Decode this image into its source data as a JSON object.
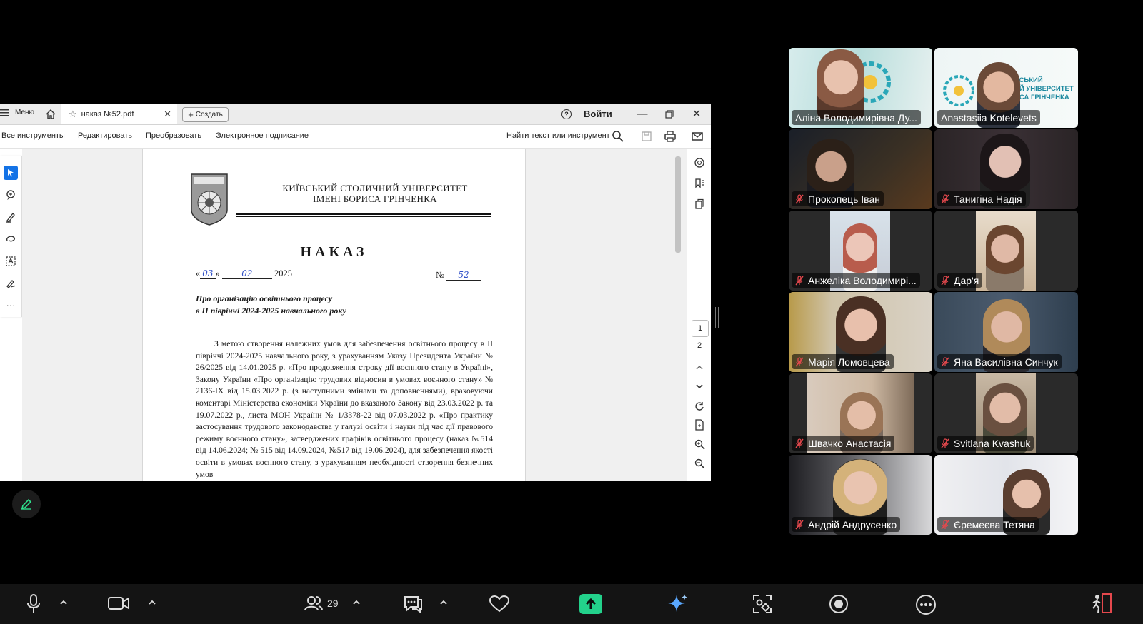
{
  "pdf_viewer": {
    "menu_label": "Меню",
    "tab_title": "наказ №52.pdf",
    "create_label": "Создать",
    "login_label": "Войти",
    "tools": [
      "Все инструменты",
      "Редактировать",
      "Преобразовать",
      "Электронное подписание"
    ],
    "find_placeholder": "Найти текст или инструмент",
    "page_numbers": [
      "1",
      "2"
    ]
  },
  "document": {
    "university": "КИЇВСЬКИЙ СТОЛИЧНИЙ УНІВЕРСИТЕТ",
    "university_sub": "ІМЕНІ БОРИСА ГРІНЧЕНКА",
    "heading": "НАКАЗ",
    "date_open": "«",
    "date_day": "03",
    "date_close": "»",
    "date_month": "02",
    "date_year": "2025",
    "number_label": "№",
    "number_value": "52",
    "subject_line1": "Про організацію освітнього процесу",
    "subject_line2": "в ІІ півріччі 2024-2025 навчального року",
    "body": "З метою створення належних умов для забезпечення освітнього процесу в ІІ півріччі 2024-2025 навчального року, з урахуванням Указу Президента України № 26/2025 від 14.01.2025 р. «Про продовження строку дії воєнного стану в Україні», Закону України «Про організацію трудових відносин в умовах воєнного стану» № 2136-ІХ від 15.03.2022 р. (з наступними змінами та доповненнями), враховуючи коментарі Міністерства економіки України до вказаного Закону від 23.03.2022 р. та 19.07.2022 р., листа МОН України № 1/3378-22 від 07.03.2022 р. «Про практику застосування трудового законодавства у галузі освіти і науки під час дії правового режиму воєнного стану», затверджених графіків освітнього процесу (наказ №514 від 14.06.2024; № 515 від 14.09.2024, №517 від 19.06.2024), для забезпечення якості освіти в умовах воєнного стану, з урахуванням необхідності створення безпечних умов"
  },
  "participants": [
    {
      "name": "Аліна Володимирівна Ду...",
      "muted": false,
      "speaking": true
    },
    {
      "name": "Anastasiia Kotelevets",
      "muted": false,
      "speaking": false
    },
    {
      "name": "Прокопець Іван",
      "muted": true,
      "speaking": false
    },
    {
      "name": "Танигіна Надія",
      "muted": true,
      "speaking": false
    },
    {
      "name": "Анжеліка Володимирі...",
      "muted": true,
      "speaking": false
    },
    {
      "name": "Дар'я",
      "muted": true,
      "speaking": false
    },
    {
      "name": "Марія Ломовцева",
      "muted": true,
      "speaking": false
    },
    {
      "name": "Яна Василівна Синчук",
      "muted": true,
      "speaking": false
    },
    {
      "name": "Швачко Анастасія",
      "muted": true,
      "speaking": false
    },
    {
      "name": "Svitlana Kvashuk",
      "muted": true,
      "speaking": false
    },
    {
      "name": "Андрій Андрусенко",
      "muted": true,
      "speaking": false
    },
    {
      "name": "Єремеєва Тетяна",
      "muted": true,
      "speaking": false
    }
  ],
  "meeting_bar": {
    "participants_count": "29",
    "share_color": "#23d18b",
    "ai_color": "#5aa8ff"
  },
  "colors": {
    "speaker_outline": "#2ee08c",
    "acrobat_blue": "#1473e6",
    "mute_red": "#e5484d"
  }
}
